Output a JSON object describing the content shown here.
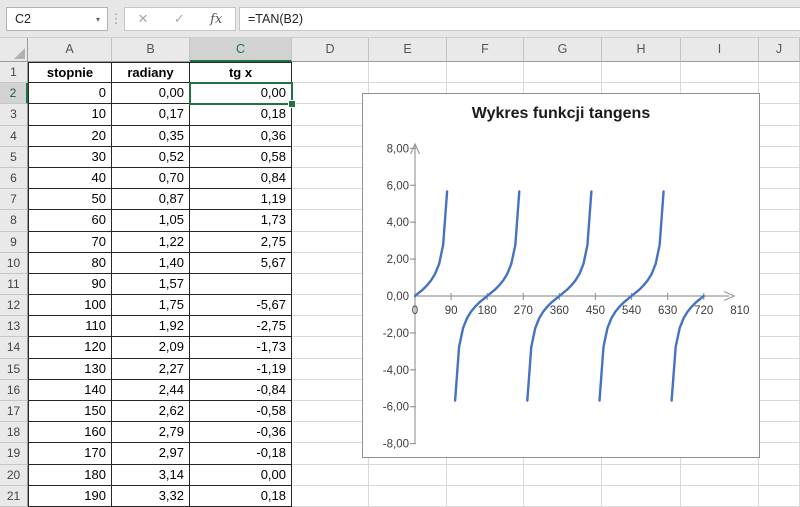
{
  "formula_bar": {
    "name_box": "C2",
    "name_box_caret": "▾",
    "cancel_label": "✕",
    "enter_label": "✓",
    "fx_label": "fx",
    "formula": "=TAN(B2)"
  },
  "sheet": {
    "columns": [
      "A",
      "B",
      "C",
      "D",
      "E",
      "F",
      "G",
      "H",
      "I",
      "J"
    ],
    "selected_cell": "C2",
    "selected_column": "C",
    "selected_row": "2",
    "rows": [
      {
        "n": "1",
        "a": "stopnie",
        "b": "radiany",
        "c": "tg x"
      },
      {
        "n": "2",
        "a": "0",
        "b": "0,00",
        "c": "0,00"
      },
      {
        "n": "3",
        "a": "10",
        "b": "0,17",
        "c": "0,18"
      },
      {
        "n": "4",
        "a": "20",
        "b": "0,35",
        "c": "0,36"
      },
      {
        "n": "5",
        "a": "30",
        "b": "0,52",
        "c": "0,58"
      },
      {
        "n": "6",
        "a": "40",
        "b": "0,70",
        "c": "0,84"
      },
      {
        "n": "7",
        "a": "50",
        "b": "0,87",
        "c": "1,19"
      },
      {
        "n": "8",
        "a": "60",
        "b": "1,05",
        "c": "1,73"
      },
      {
        "n": "9",
        "a": "70",
        "b": "1,22",
        "c": "2,75"
      },
      {
        "n": "10",
        "a": "80",
        "b": "1,40",
        "c": "5,67"
      },
      {
        "n": "11",
        "a": "90",
        "b": "1,57",
        "c": ""
      },
      {
        "n": "12",
        "a": "100",
        "b": "1,75",
        "c": "-5,67"
      },
      {
        "n": "13",
        "a": "110",
        "b": "1,92",
        "c": "-2,75"
      },
      {
        "n": "14",
        "a": "120",
        "b": "2,09",
        "c": "-1,73"
      },
      {
        "n": "15",
        "a": "130",
        "b": "2,27",
        "c": "-1,19"
      },
      {
        "n": "16",
        "a": "140",
        "b": "2,44",
        "c": "-0,84"
      },
      {
        "n": "17",
        "a": "150",
        "b": "2,62",
        "c": "-0,58"
      },
      {
        "n": "18",
        "a": "160",
        "b": "2,79",
        "c": "-0,36"
      },
      {
        "n": "19",
        "a": "170",
        "b": "2,97",
        "c": "-0,18"
      },
      {
        "n": "20",
        "a": "180",
        "b": "3,14",
        "c": "0,00"
      },
      {
        "n": "21",
        "a": "190",
        "b": "3,32",
        "c": "0,18"
      }
    ]
  },
  "chart_data": {
    "type": "line",
    "title": "Wykres funkcji tangens",
    "x_start": 0,
    "x_step": 10,
    "values": [
      0,
      0.18,
      0.36,
      0.58,
      0.84,
      1.19,
      1.73,
      2.75,
      5.67,
      null,
      -5.67,
      -2.75,
      -1.73,
      -1.19,
      -0.84,
      -0.58,
      -0.36,
      -0.18,
      0,
      0.18,
      0.36,
      0.58,
      0.84,
      1.19,
      1.73,
      2.75,
      5.67,
      null,
      -5.67,
      -2.75,
      -1.73,
      -1.19,
      -0.84,
      -0.58,
      -0.36,
      -0.18,
      0,
      0.18,
      0.36,
      0.58,
      0.84,
      1.19,
      1.73,
      2.75,
      5.67,
      null,
      -5.67,
      -2.75,
      -1.73,
      -1.19,
      -0.84,
      -0.58,
      -0.36,
      -0.18,
      0,
      0.18,
      0.36,
      0.58,
      0.84,
      1.19,
      1.73,
      2.75,
      5.67,
      null,
      -5.67,
      -2.75,
      -1.73,
      -1.19,
      -0.84,
      -0.58,
      -0.36,
      -0.18,
      0
    ],
    "x_ticks": [
      0,
      90,
      180,
      270,
      360,
      450,
      540,
      630,
      720,
      810
    ],
    "x_tick_labels": [
      "0",
      "90",
      "180",
      "270",
      "360",
      "450",
      "540",
      "630",
      "720",
      "810"
    ],
    "y_ticks": [
      8,
      6,
      4,
      2,
      0,
      -2,
      -4,
      -6,
      -8
    ],
    "y_tick_labels": [
      "8,00",
      "6,00",
      "4,00",
      "2,00",
      "0,00",
      "-2,00",
      "-4,00",
      "-6,00",
      "-8,00"
    ],
    "xlim": [
      0,
      840
    ],
    "ylim": [
      -8,
      8
    ],
    "grid": false,
    "legend": "none",
    "line_color": "#4472C4",
    "axis_color": "#9b9b9b",
    "selection_color": "#217346"
  }
}
